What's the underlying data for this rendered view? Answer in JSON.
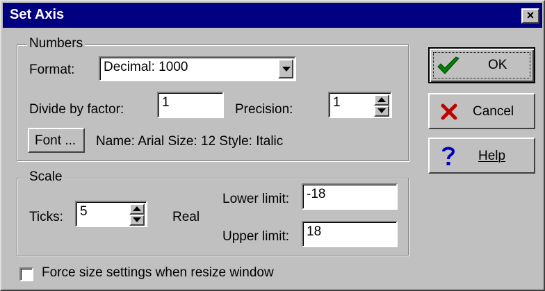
{
  "window": {
    "title": "Set Axis",
    "close_glyph": "×"
  },
  "numbers": {
    "legend": "Numbers",
    "format_label": "Format:",
    "format_value": "Decimal:  1000",
    "divide_label": "Divide by factor:",
    "divide_value": "1",
    "precision_label": "Precision:",
    "precision_value": "1",
    "font_button": "Font ...",
    "font_info": "Name: Arial Size: 12 Style: Italic"
  },
  "scale": {
    "legend": "Scale",
    "ticks_label": "Ticks:",
    "ticks_value": "5",
    "real_label": "Real",
    "lower_label": "Lower limit:",
    "lower_value": "-18",
    "upper_label": "Upper limit:",
    "upper_value": "18"
  },
  "options": {
    "force_size_label": "Force size settings when resize window",
    "force_size_checked": false
  },
  "buttons": {
    "ok": "OK",
    "cancel": "Cancel",
    "help": "Help"
  },
  "colors": {
    "titlebar": "#000080",
    "face": "#c0c0c0",
    "ok_check": "#008000",
    "cancel_x": "#c00000",
    "help_q": "#0000c0"
  }
}
